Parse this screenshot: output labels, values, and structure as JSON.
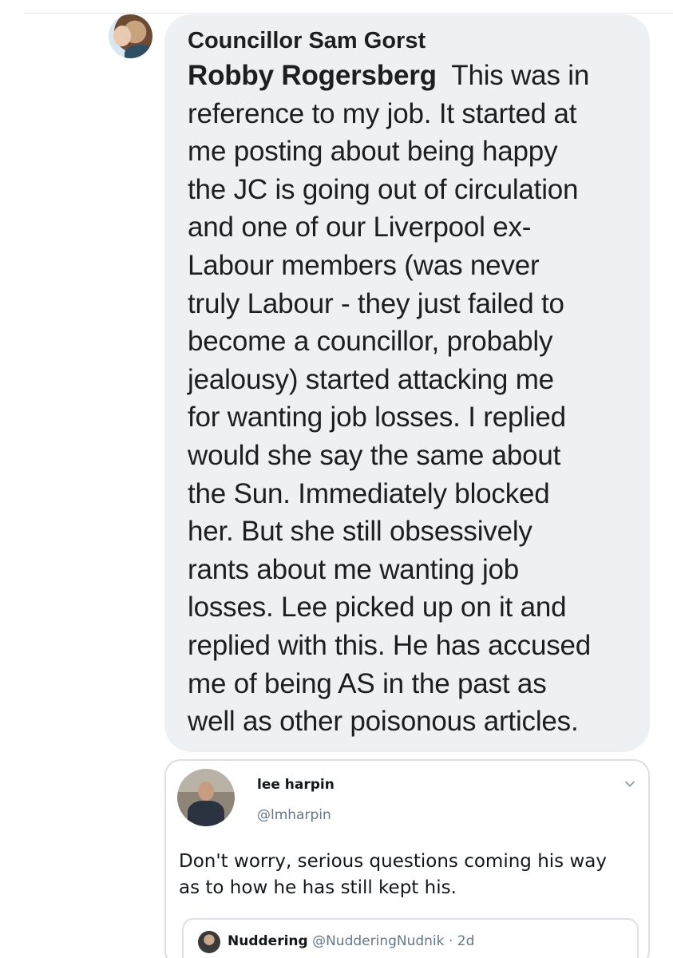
{
  "comment": {
    "author": "Councillor Sam Gorst",
    "mention": "Robby Rogersberg",
    "first_line_rest": "This was in",
    "lines": [
      "reference to my job. It started at",
      "me posting about being happy",
      "the JC is going out of circulation",
      "and one of our Liverpool ex-",
      "Labour members (was never",
      "truly Labour - they just failed to",
      "become a councillor, probably",
      "jealousy) started attacking me",
      "for wanting job losses. I replied",
      "would she say the same about",
      "the Sun. Immediately blocked",
      "her. But she still obsessively",
      "rants about me wanting job",
      "losses. Lee picked up on it and",
      "replied with this. He has accused",
      "me of being AS in the past as",
      "well as other poisonous articles."
    ]
  },
  "embedded_tweet": {
    "name": "lee harpin",
    "handle": "@lmharpin",
    "text_lines": [
      "Don't worry, serious questions coming his way",
      "as to how he has still kept his."
    ],
    "icons": {
      "menu": "chevron-down-icon"
    },
    "quoted": {
      "name": "Nuddering",
      "handle": "@NudderingNudnik",
      "separator": "·",
      "age": "2d"
    }
  },
  "colors": {
    "bubble_bg": "#eef1f3",
    "text": "#1c1e21",
    "muted": "#657786",
    "border": "#dcdfe3"
  }
}
